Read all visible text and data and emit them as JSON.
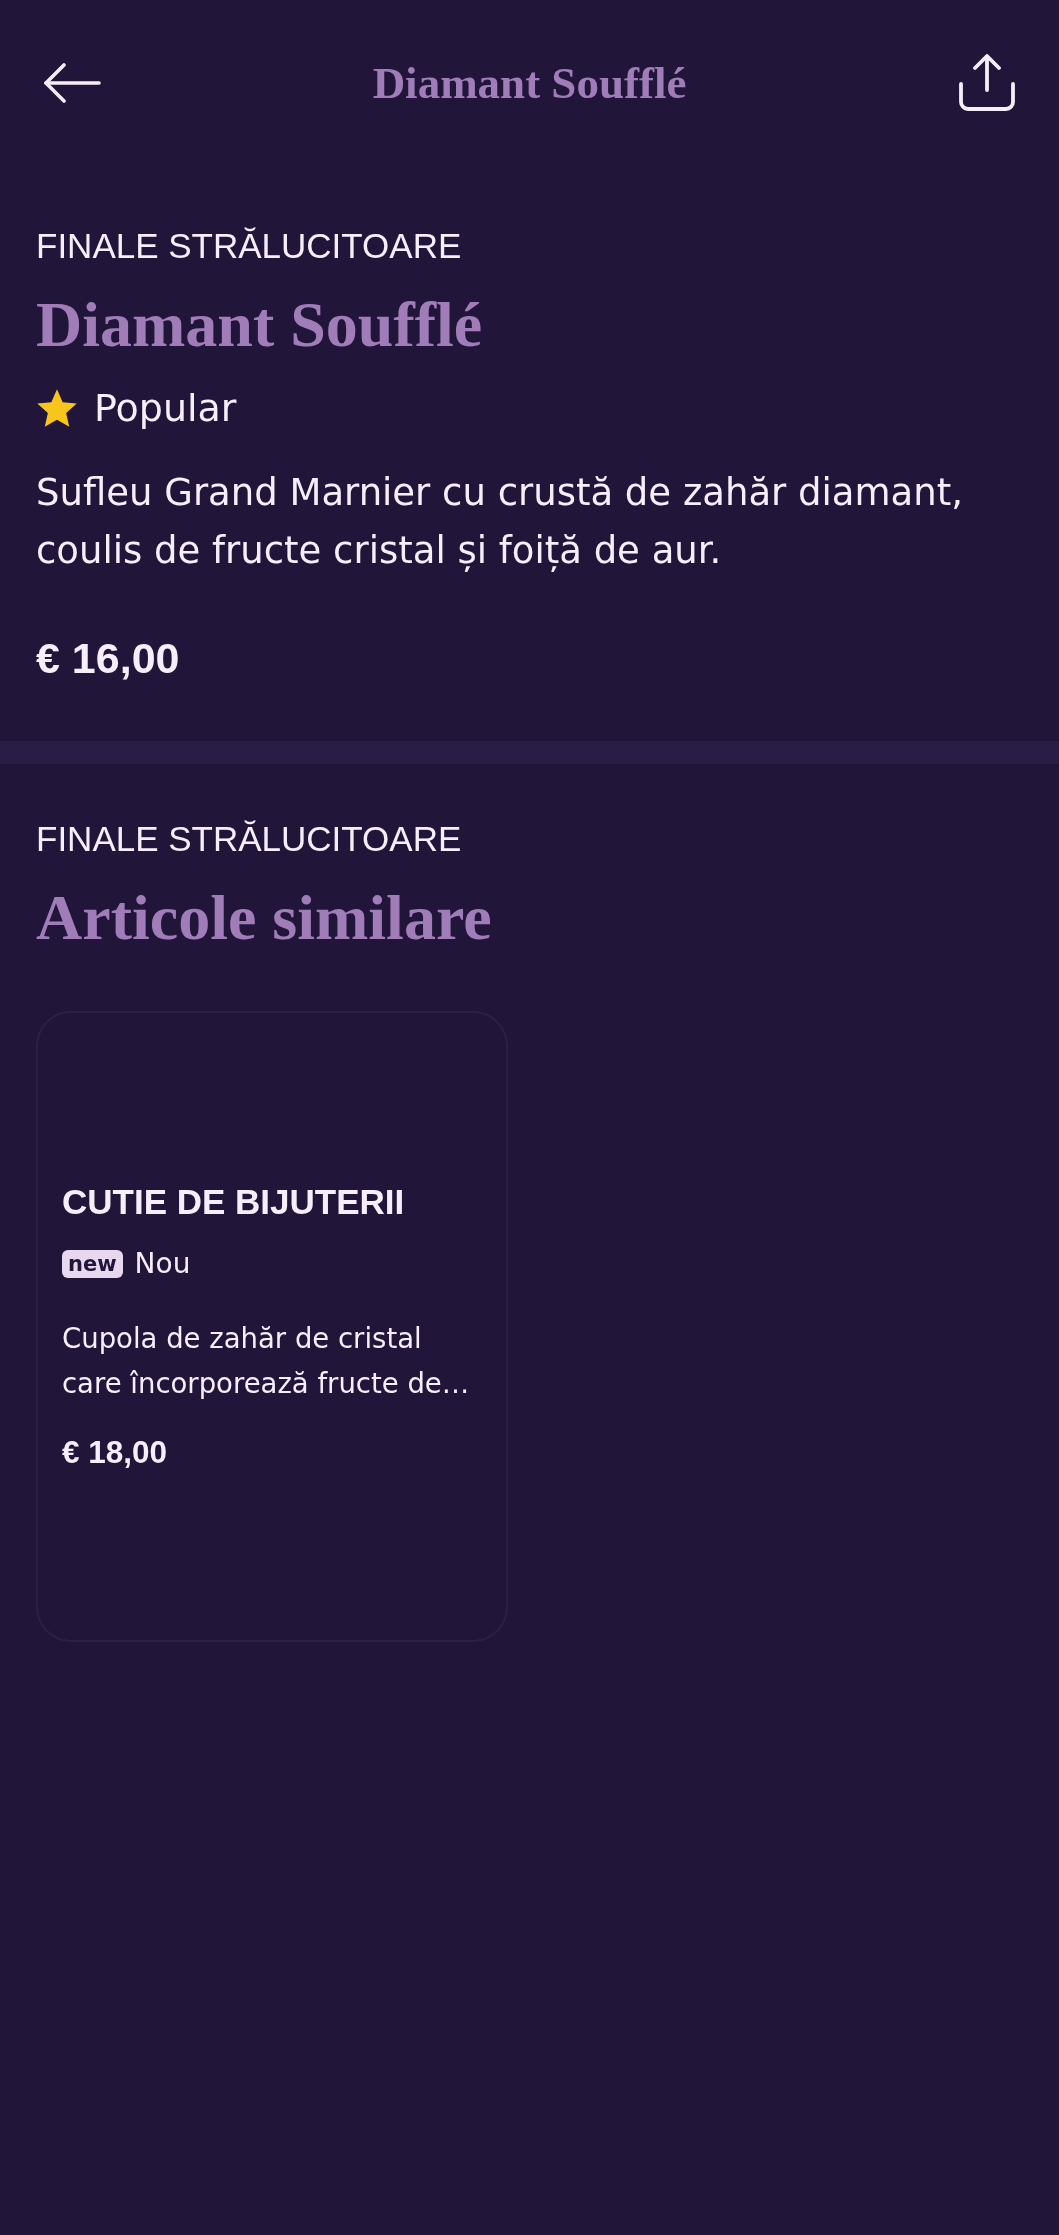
{
  "header": {
    "title": "Diamant Soufflé"
  },
  "product": {
    "category": "FINALE STRĂLUCITOARE",
    "name": "Diamant Soufflé",
    "tags": [
      {
        "kind": "star",
        "label": "Popular"
      }
    ],
    "description": "Sufleu Grand Marnier cu crustă de zahăr diamant, coulis de fructe cristal și foiță de aur.",
    "price": "€ 16,00"
  },
  "similar": {
    "category": "FINALE STRĂLUCITOARE",
    "title": "Articole similare",
    "items": [
      {
        "name": "CUTIE DE BIJUTERII",
        "tags": [
          {
            "kind": "new",
            "badge": "new",
            "label": "Nou"
          }
        ],
        "description": "Cupola de zahăr de cristal care încorporează fructe de…",
        "price": "€ 18,00"
      }
    ]
  }
}
